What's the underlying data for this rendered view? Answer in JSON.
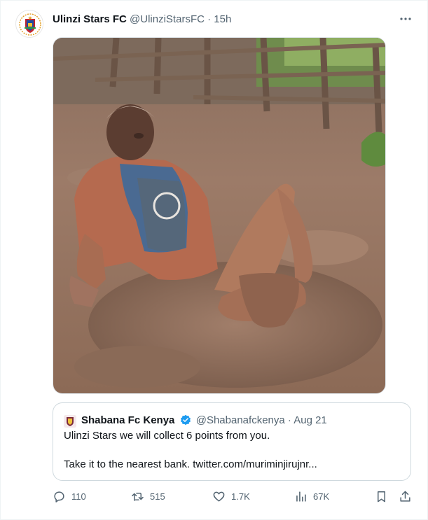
{
  "tweet": {
    "author_name": "Ulinzi Stars FC",
    "author_handle": "@UlinziStarsFC",
    "separator": "·",
    "timestamp": "15h",
    "more_icon": "more-dots-icon",
    "media": {
      "alt_description_shown": false
    },
    "quoted": {
      "author_name": "Shabana Fc Kenya",
      "author_handle": "@Shabanafckenya",
      "separator": "·",
      "date": "Aug 21",
      "verified_color": "#1d9bf0",
      "line1": "Ulinzi Stars we will collect 6 points from you.",
      "line2": "Take it to the nearest bank. twitter.com/muriminjirujnr..."
    },
    "actions": {
      "replies": "110",
      "retweets": "515",
      "likes": "1.7K",
      "views": "67K"
    }
  },
  "colors": {
    "text": "#0f1419",
    "muted": "#536471",
    "border": "#cfd9de",
    "accent": "#1d9bf0"
  }
}
